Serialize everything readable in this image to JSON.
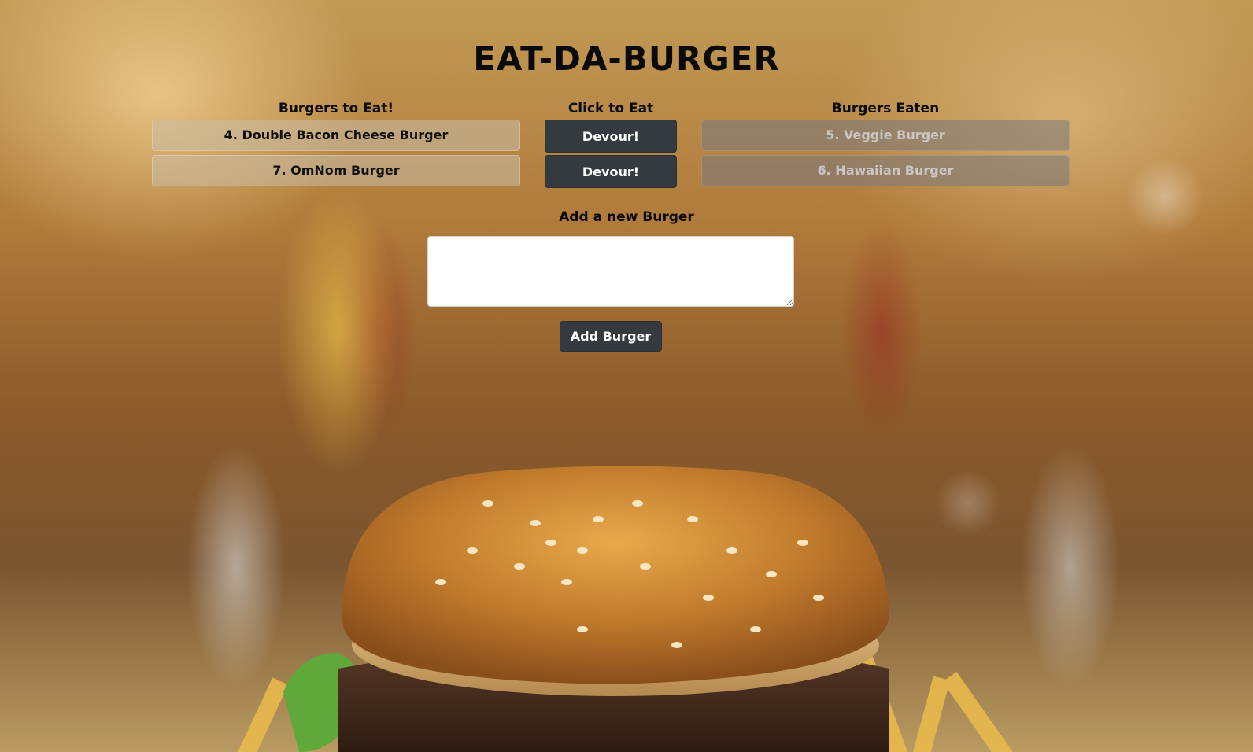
{
  "header": {
    "title": "EAT-DA-BURGER"
  },
  "columns": {
    "to_eat_heading": "Burgers to Eat!",
    "click_heading": "Click to Eat",
    "eaten_heading": "Burgers Eaten"
  },
  "burgers_to_eat": [
    {
      "label": "4. Double Bacon Cheese Burger",
      "button": "Devour!"
    },
    {
      "label": "7. OmNom Burger",
      "button": "Devour!"
    }
  ],
  "burgers_eaten": [
    {
      "label": "5. Veggie Burger"
    },
    {
      "label": "6. Hawaiian Burger"
    }
  ],
  "add_form": {
    "label": "Add a new Burger",
    "textarea_value": "",
    "submit_label": "Add Burger"
  },
  "colors": {
    "button_bg": "#343a40",
    "button_text": "#ffffff"
  }
}
